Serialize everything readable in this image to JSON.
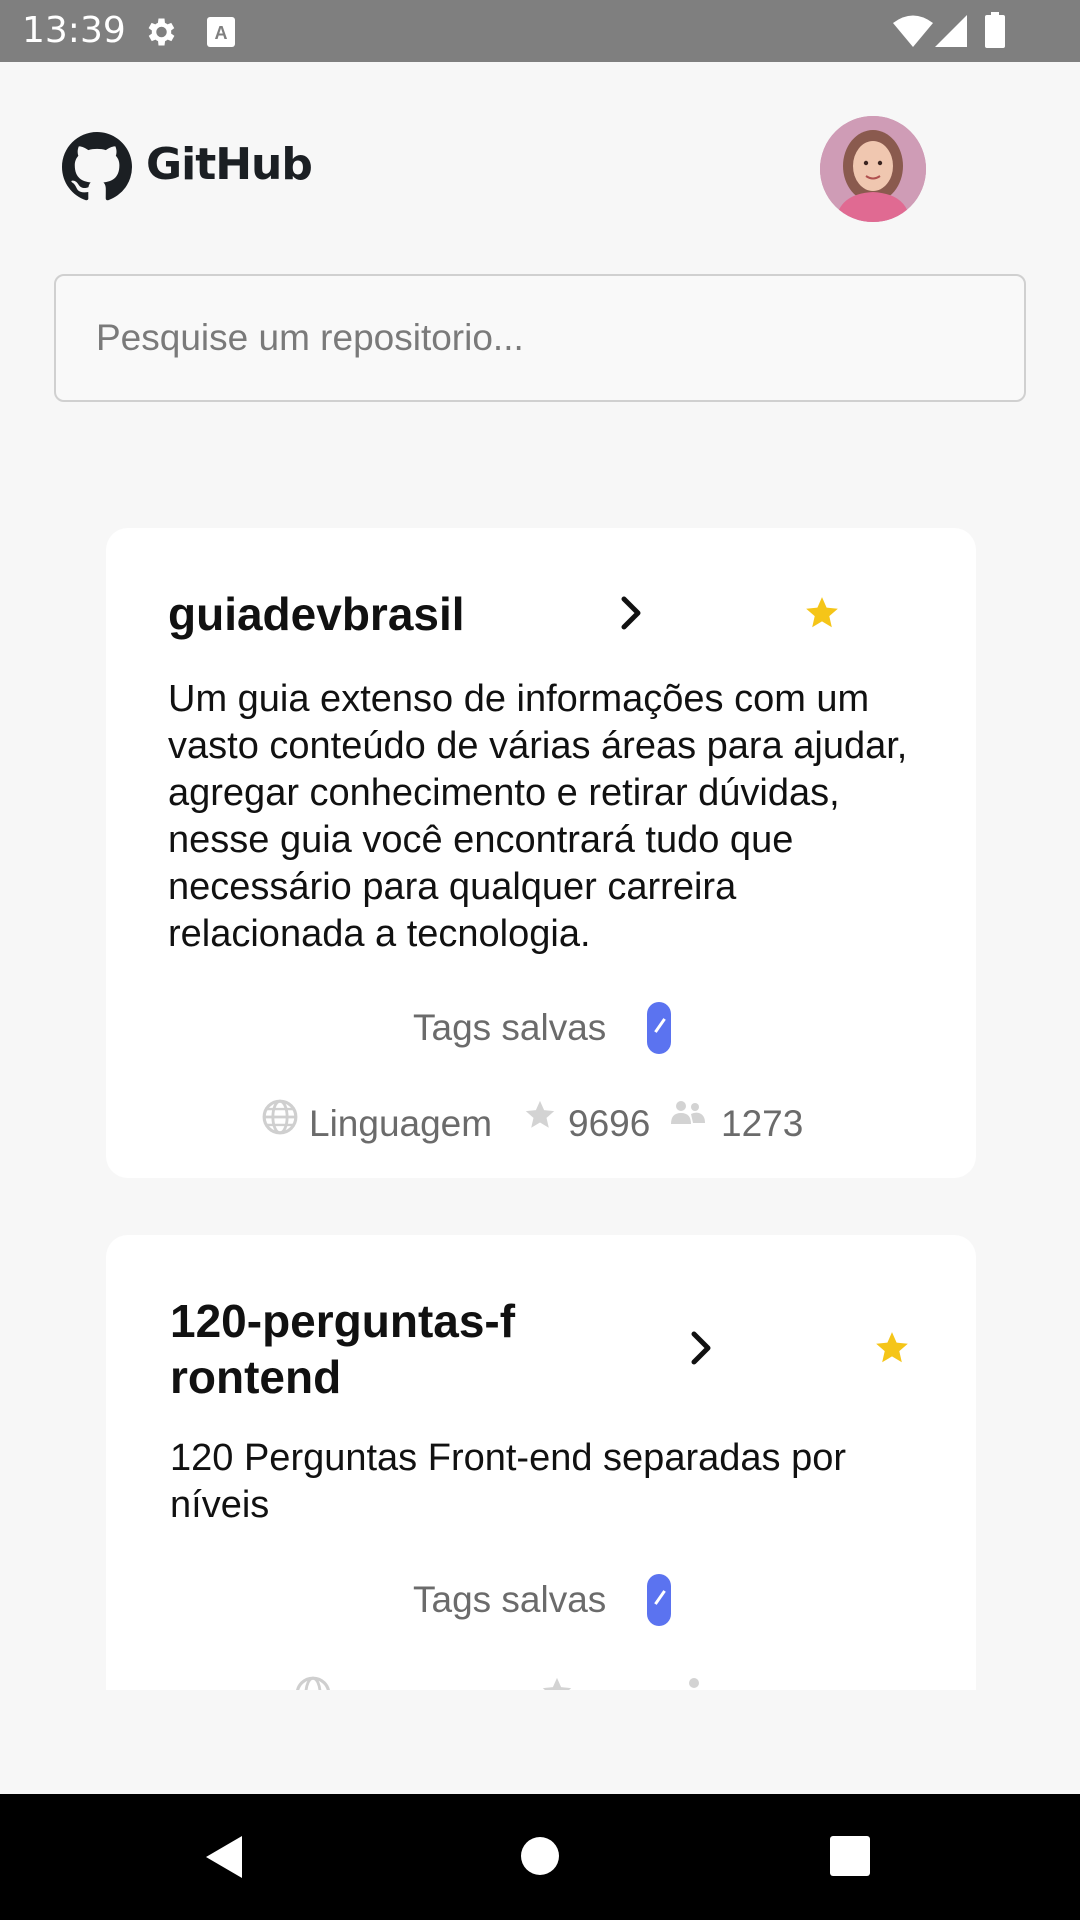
{
  "status_bar": {
    "time": "13:39",
    "icons": [
      "gear-icon",
      "a-icon",
      "wifi-icon",
      "signal-icon",
      "battery-icon"
    ]
  },
  "header": {
    "logo_text": "GitHub"
  },
  "search": {
    "placeholder": "Pesquise um repositorio..."
  },
  "repos": [
    {
      "name": "guiadevbrasil",
      "description": "Um guia extenso de informações com um vasto conteúdo de várias áreas para ajudar, agregar conhecimento e retirar dúvidas, nesse guia você encontrará tudo que necessário para qualquer carreira relacionada a tecnologia.",
      "tags_label": "Tags salvas",
      "language_label": "Linguagem",
      "stars": "9696",
      "forks": "1273"
    },
    {
      "name_line1": "120-perguntas-f",
      "name_line2": "rontend",
      "description": "120 Perguntas Front-end separadas por níveis",
      "tags_label": "Tags salvas"
    }
  ],
  "colors": {
    "star": "#f5c518",
    "tag_pill": "#5b73f0",
    "status_bar": "#7f7f7f"
  }
}
